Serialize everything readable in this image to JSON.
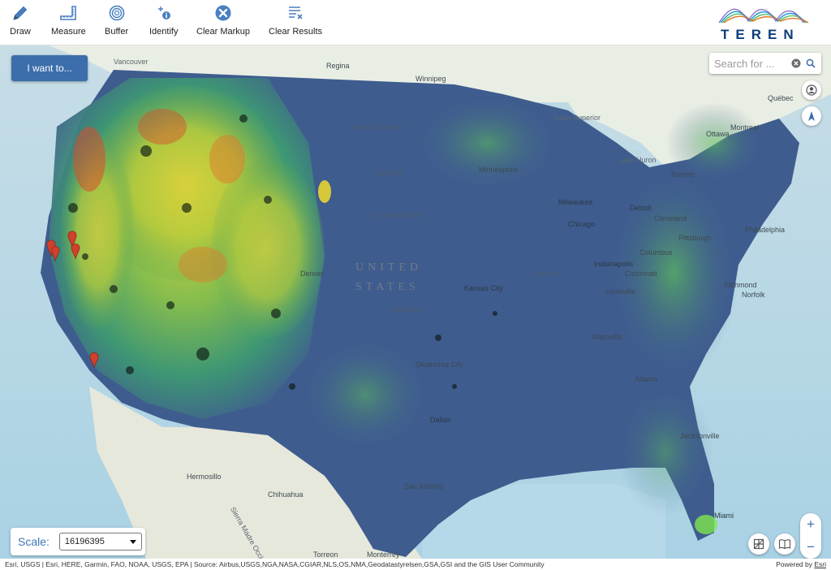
{
  "toolbar": {
    "tools": [
      {
        "id": "draw",
        "label": "Draw",
        "icon": "pencil-icon",
        "has_menu": true
      },
      {
        "id": "measure",
        "label": "Measure",
        "icon": "ruler-icon",
        "has_menu": true
      },
      {
        "id": "buffer",
        "label": "Buffer",
        "icon": "buffer-rings-icon",
        "has_menu": true
      },
      {
        "id": "identify",
        "label": "Identify",
        "icon": "identify-icon",
        "has_menu": false
      },
      {
        "id": "clear_markup",
        "label": "Clear Markup",
        "icon": "close-circle-icon",
        "has_menu": false
      },
      {
        "id": "clear_results",
        "label": "Clear Results",
        "icon": "clear-list-icon",
        "has_menu": false
      }
    ],
    "logo_text": "TEREN"
  },
  "map": {
    "i_want_to_label": "I want to...",
    "search": {
      "placeholder": "Search for ..."
    },
    "country_label_line1": "UNITED",
    "country_label_line2": "STATES",
    "region_label": "Great Plains",
    "labels": {
      "vancouver": "Vancouver",
      "regina": "Regina",
      "winnipeg": "Winnipeg",
      "quebec": "Québec",
      "ottawa": "Ottawa",
      "montreal": "Montreal",
      "toronto": "Toronto",
      "minneapolis": "Minneapolis",
      "milwaukee": "Milwaukee",
      "chicago": "Chicago",
      "detroit": "Detroit",
      "cleveland": "Cleveland",
      "pittsburgh": "Pittsburgh",
      "philadelphia": "Philadelphia",
      "indianapolis": "Indianapolis",
      "columbus": "Columbus",
      "cincinnati": "Cincinnati",
      "louisville": "Louisville",
      "richmond": "Richmond",
      "norfolk": "Norfolk",
      "kansas_city": "Kansas City",
      "denver": "Denver",
      "nashville": "Nashville",
      "atlanta": "Atlanta",
      "oklahoma_city": "Oklahoma City",
      "dallas": "Dallas",
      "jacksonville": "Jacksonville",
      "miami": "Miami",
      "san_antonio": "San Antonio",
      "hermosillo": "Hermosillo",
      "chihuahua": "Chihuahua",
      "torreon": "Torreon",
      "monterrey": "Monterrey",
      "north_dakota": "North Dakota",
      "dakota": "Dakota",
      "kansas": "Kansas",
      "illinois": "Illinois",
      "lake_superior": "Lake Superior",
      "lake_huron": "Lake Huron",
      "sierra_madre": "Sierra Madre Occidental"
    },
    "scale": {
      "label": "Scale:",
      "value": "16196395"
    },
    "zoom_in": "+",
    "zoom_out": "−"
  },
  "attribution": {
    "text": "Esri, USGS | Esri, HERE, Garmin, FAO, NOAA, USGS, EPA | Source: Airbus,USGS,NGA,NASA,CGIAR,NLS,OS,NMA,Geodatastyrelsen,GSA,GSI and the GIS User Community",
    "powered_prefix": "Powered by ",
    "powered_link": "Esri"
  },
  "colors": {
    "accent": "#3b6eab",
    "logo_blue": "#0d3f78",
    "raster_low": "#3f5c8f",
    "raster_mid": "#4aa46a",
    "raster_high": "#e6d432",
    "raster_peak": "#d94c2c"
  }
}
